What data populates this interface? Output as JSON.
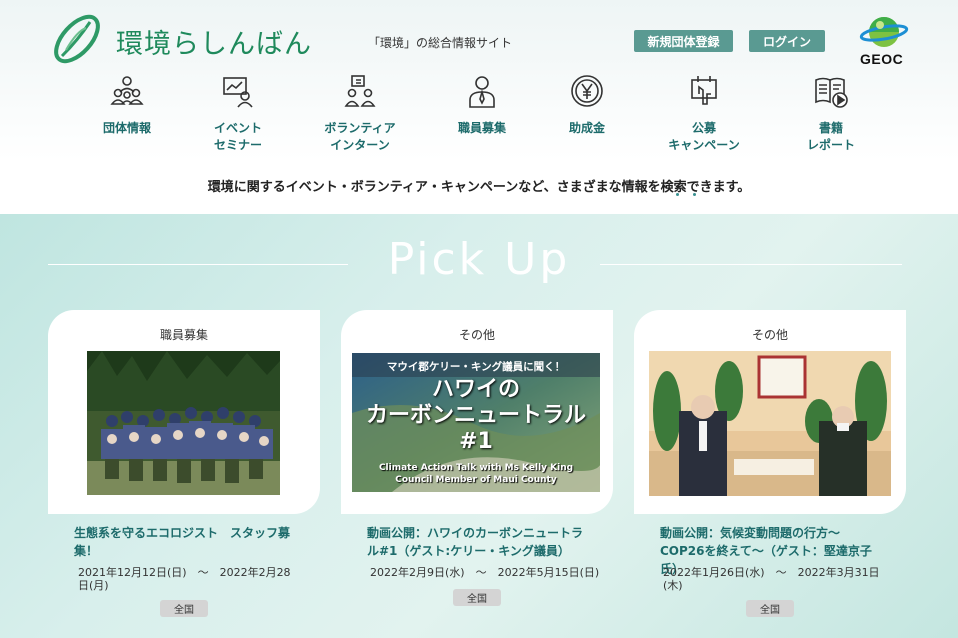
{
  "header": {
    "logo_text": "環境らしんばん",
    "tagline": "「環境」の総合情報サイト",
    "register_button": "新規団体登録",
    "login_button": "ログイン",
    "partner_logo": "GEOC"
  },
  "nav": {
    "items": [
      {
        "label": "団体情報",
        "icon": "group-icon"
      },
      {
        "label": "イベント\nセミナー",
        "icon": "seminar-icon"
      },
      {
        "label": "ボランティア\nインターン",
        "icon": "volunteer-icon"
      },
      {
        "label": "職員募集",
        "icon": "staff-icon"
      },
      {
        "label": "助成金",
        "icon": "yen-coin-icon"
      },
      {
        "label": "公募\nキャンペーン",
        "icon": "campaign-icon"
      },
      {
        "label": "書籍\nレポート",
        "icon": "book-report-icon"
      }
    ]
  },
  "description": "環境に関するイベント・ボランティア・キャンペーンなど、さまざまな情報を検索できます。",
  "pickup": {
    "title": "Pick Up",
    "cards": [
      {
        "category": "職員募集",
        "title": "生態系を守るエコロジスト　スタッフ募集！",
        "date": "2021年12月12日(日)　～　2022年2月28日(月)",
        "badge": "全国"
      },
      {
        "category": "その他",
        "image_heading": "マウイ郡ケリー・キング議員に聞く！",
        "image_title_line1": "ハワイの",
        "image_title_line2": "カーボンニュートラル",
        "image_title_line3": "#1",
        "image_sub1": "Climate Action Talk with Ms Kelly King",
        "image_sub2": "Council Member of Maui County",
        "title": "動画公開：ハワイのカーボンニュートラル#1（ゲスト:ケリー・キング議員）",
        "date": "2022年2月9日(水)　～　2022年5月15日(日)",
        "badge": "全国"
      },
      {
        "category": "その他",
        "title": "動画公開：気候変動問題の行方～COP26を終えて～（ゲスト：堅達京子氏）",
        "date": "2022年1月26日(水)　～　2022年3月31日(木)",
        "badge": "全国"
      }
    ]
  }
}
